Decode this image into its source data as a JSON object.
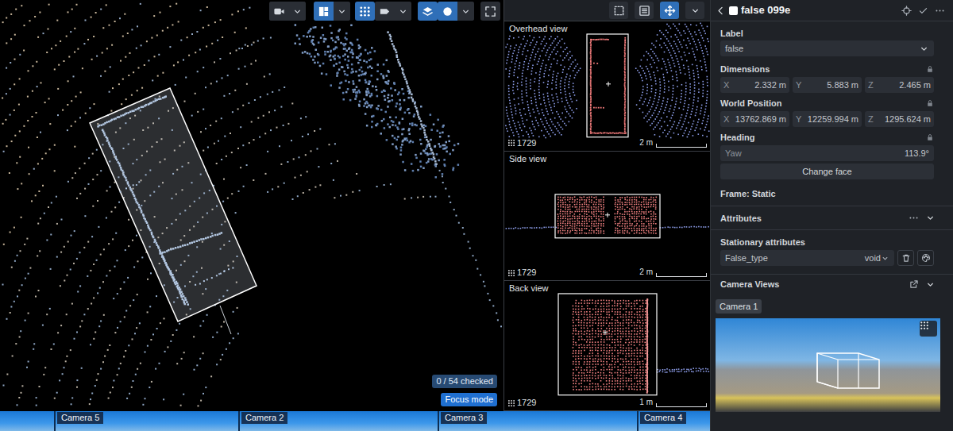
{
  "main": {
    "toolbar": [
      {
        "selected": false
      },
      {
        "selected": true
      },
      {
        "selected": true
      },
      {
        "selected": false
      },
      {
        "selected": true
      },
      {
        "selected": true
      },
      {
        "selected": false
      }
    ],
    "checked_badge": "0 / 54 checked",
    "focus_badge": "Focus mode"
  },
  "view_toolbar": [
    {
      "selected": false
    },
    {
      "selected": false
    },
    {
      "selected": true
    }
  ],
  "views": [
    {
      "title": "Overhead view",
      "count": "1729",
      "scale": "2 m"
    },
    {
      "title": "Side view",
      "count": "1729",
      "scale": "2 m"
    },
    {
      "title": "Back view",
      "count": "1729",
      "scale": "1 m"
    }
  ],
  "cameras": [
    {
      "label": "Camera 5"
    },
    {
      "label": "Camera 2"
    },
    {
      "label": "Camera 3"
    },
    {
      "label": "Camera 4"
    }
  ],
  "panel": {
    "title": "false 099e",
    "label": {
      "heading": "Label",
      "value": "false"
    },
    "dimensions": {
      "heading": "Dimensions",
      "fields": [
        {
          "axis": "X",
          "value": "2.332 m"
        },
        {
          "axis": "Y",
          "value": "5.883 m"
        },
        {
          "axis": "Z",
          "value": "2.465 m"
        }
      ]
    },
    "position": {
      "heading": "World Position",
      "fields": [
        {
          "axis": "X",
          "value": "13762.869 m"
        },
        {
          "axis": "Y",
          "value": "12259.994 m"
        },
        {
          "axis": "Z",
          "value": "1295.624 m"
        }
      ]
    },
    "heading": {
      "heading": "Heading",
      "field": {
        "axis": "Yaw",
        "value": "113.9°"
      },
      "button": "Change face"
    },
    "frame": "Frame: Static",
    "attributes": {
      "heading": "Attributes",
      "subheading": "Stationary attributes",
      "field": {
        "name": "False_type",
        "value": "void"
      }
    },
    "camera_views": {
      "heading": "Camera Views",
      "tabs": [
        {
          "label": "Camera 1",
          "selected": true
        }
      ]
    }
  }
}
